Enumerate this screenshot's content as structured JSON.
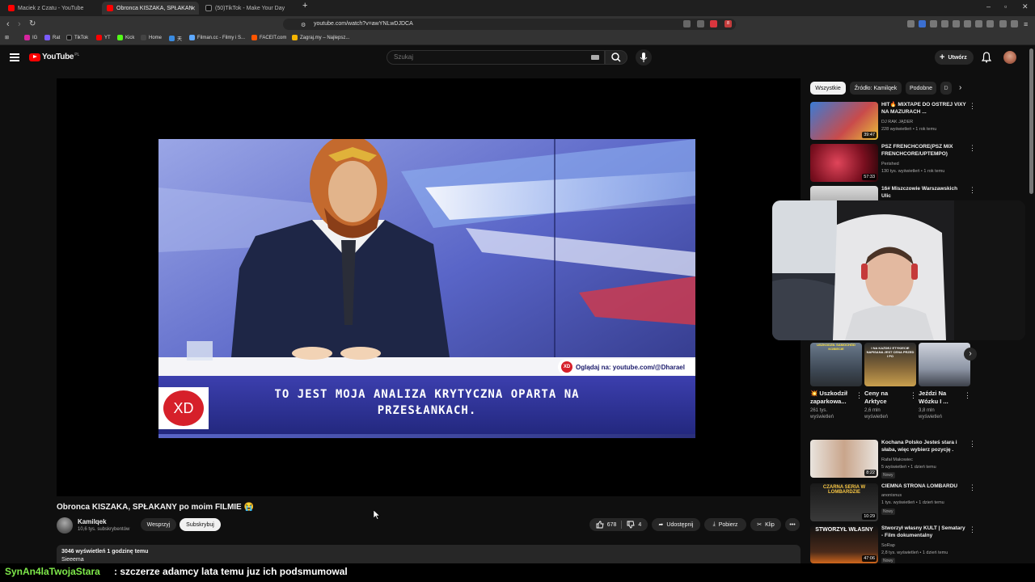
{
  "browser": {
    "tabs": [
      {
        "label": "Maciek z Czatu - YouTube",
        "active": false,
        "color": "#ff0000"
      },
      {
        "label": "Obronca KISZAKA, SPŁAKAN",
        "active": true,
        "color": "#ff0000"
      },
      {
        "label": "(50)TikTok - Make Your Day",
        "active": false,
        "color": "#111111"
      }
    ],
    "new_tab": "+",
    "url": "youtube.com/watch?v=awYNLwDJDCA",
    "bookmarks": [
      "IG",
      "Rat",
      "TikTok",
      "YT",
      "Kick",
      "Home",
      "天",
      "Filman.cc - Filmy i S...",
      "FACEIT.com",
      "Zagraj.my – Najlepsz..."
    ],
    "ext_badge": "8"
  },
  "youtube": {
    "logo_text": "YouTube",
    "logo_country": "PL",
    "search_placeholder": "Szukaj",
    "create_label": "Utwórz"
  },
  "video": {
    "caption_line1": "TO JEST MOJA ANALIZA KRYTYCZNA OPARTA NA",
    "caption_line2": "PRZESŁANKACH.",
    "logo_text": "XD",
    "watch_tag": "Oglądaj na: youtube.com/@Dharael",
    "watch_tag_logo": "XD",
    "title": "Obronca KISZAKA, SPŁAKANY po moim FILMIE 😭",
    "channel_name": "Kamilqek",
    "channel_subs": "10,6 tys. subskrybentów",
    "support_label": "Wesprzyj",
    "subscribe_label": "Subskrybuj",
    "likes": "678",
    "dislikes": "4",
    "share_label": "Udostępnij",
    "download_label": "Pobierz",
    "clip_label": "Klip",
    "views_time": "3046 wyświetleń  1 godzinę temu",
    "description": "Sieeema"
  },
  "sidebar": {
    "chips": [
      "Wszystkie",
      "Źródło: Kamilqek",
      "Podobne",
      "D"
    ],
    "recs_top": [
      {
        "title": "HIT🔥 MIXTAPE DO OSTREJ VIXY NA MAZURACH ...",
        "channel": "DJ RAK JĄDER",
        "meta": "228 wyświetleń • 1 rok temu",
        "duration": "39:47"
      },
      {
        "title": "PSZ FRENCHCORE(PSZ MIX FRENCHCORE/UPTEMPO)",
        "channel": "Perished",
        "meta": "130 tys. wyświetleń • 1 rok temu",
        "duration": "57:33"
      },
      {
        "title": "16# Miszczowie Warszawskich Ulic",
        "channel": "",
        "meta": "",
        "duration": ""
      }
    ],
    "shorts": [
      {
        "title": "💥 Uszkodził zaparkowa...",
        "views": "261 tys. wyświetleń",
        "label": "USZKODZIŁ SAMOCHÓD KOBIECIE"
      },
      {
        "title": "Ceny na Arktyce",
        "views": "2,6 mln wyświetleń",
        "label": "I NA KAŻDEJ ETYKIECIE NAPISANA JEST CENA PRZED I PO"
      },
      {
        "title": "Jeździ Na Wózku I ...",
        "views": "3,8 mln wyświetleń",
        "label": ""
      }
    ],
    "recs_bottom": [
      {
        "title": "Kochana Polsko Jesteś stara i słaba, więc wybierz pozycję .",
        "channel": "Rafał Makowiec",
        "meta": "5 wyświetleń • 1 dzień temu",
        "badge": "Nowy",
        "duration": "8:22",
        "thumb_text": ""
      },
      {
        "title": "CIEMNA STRONA LOMBARDU",
        "channel": "anonisnus",
        "meta": "1 tys. wyświetleń • 1 dzień temu",
        "badge": "Nowy",
        "duration": "10:29",
        "thumb_text": "CZARNA SERIA W LOMBARDZIE"
      },
      {
        "title": "Stworzył własny KULT | Sematary - Film dokumentalny",
        "channel": "SoRap",
        "meta": "2,8 tys. wyświetleń • 1 dzień temu",
        "badge": "Nowy",
        "duration": "47:06",
        "thumb_text": "STWORZYŁ WŁASNY"
      }
    ]
  },
  "chat": {
    "user": "SynAn4laTwojaStara",
    "message": ": szczerze adamcy lata temu juz ich podsmumowal"
  },
  "colors": {
    "yt_red": "#ff0000",
    "bg": "#0f0f0f",
    "chip_bg": "#272727",
    "chat_user": "#7ee84a"
  }
}
